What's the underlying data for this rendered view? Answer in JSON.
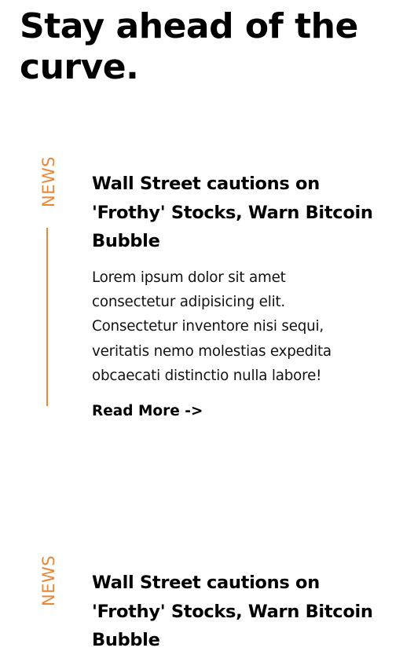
{
  "page": {
    "title": "Stay ahead of the curve."
  },
  "theme": {
    "accent": "#e8883a"
  },
  "articles": [
    {
      "category": "NEWS",
      "headline": "Wall Street cautions on 'Frothy' Stocks, Warn Bitcoin Bubble",
      "body": "Lorem ipsum dolor sit amet consectetur adipisicing elit. Consectetur inventore nisi sequi, veritatis nemo molestias expedita obcaecati distinctio nulla labore!",
      "cta": "Read More ->"
    },
    {
      "category": "NEWS",
      "headline": "Wall Street cautions on 'Frothy' Stocks, Warn Bitcoin Bubble"
    }
  ]
}
